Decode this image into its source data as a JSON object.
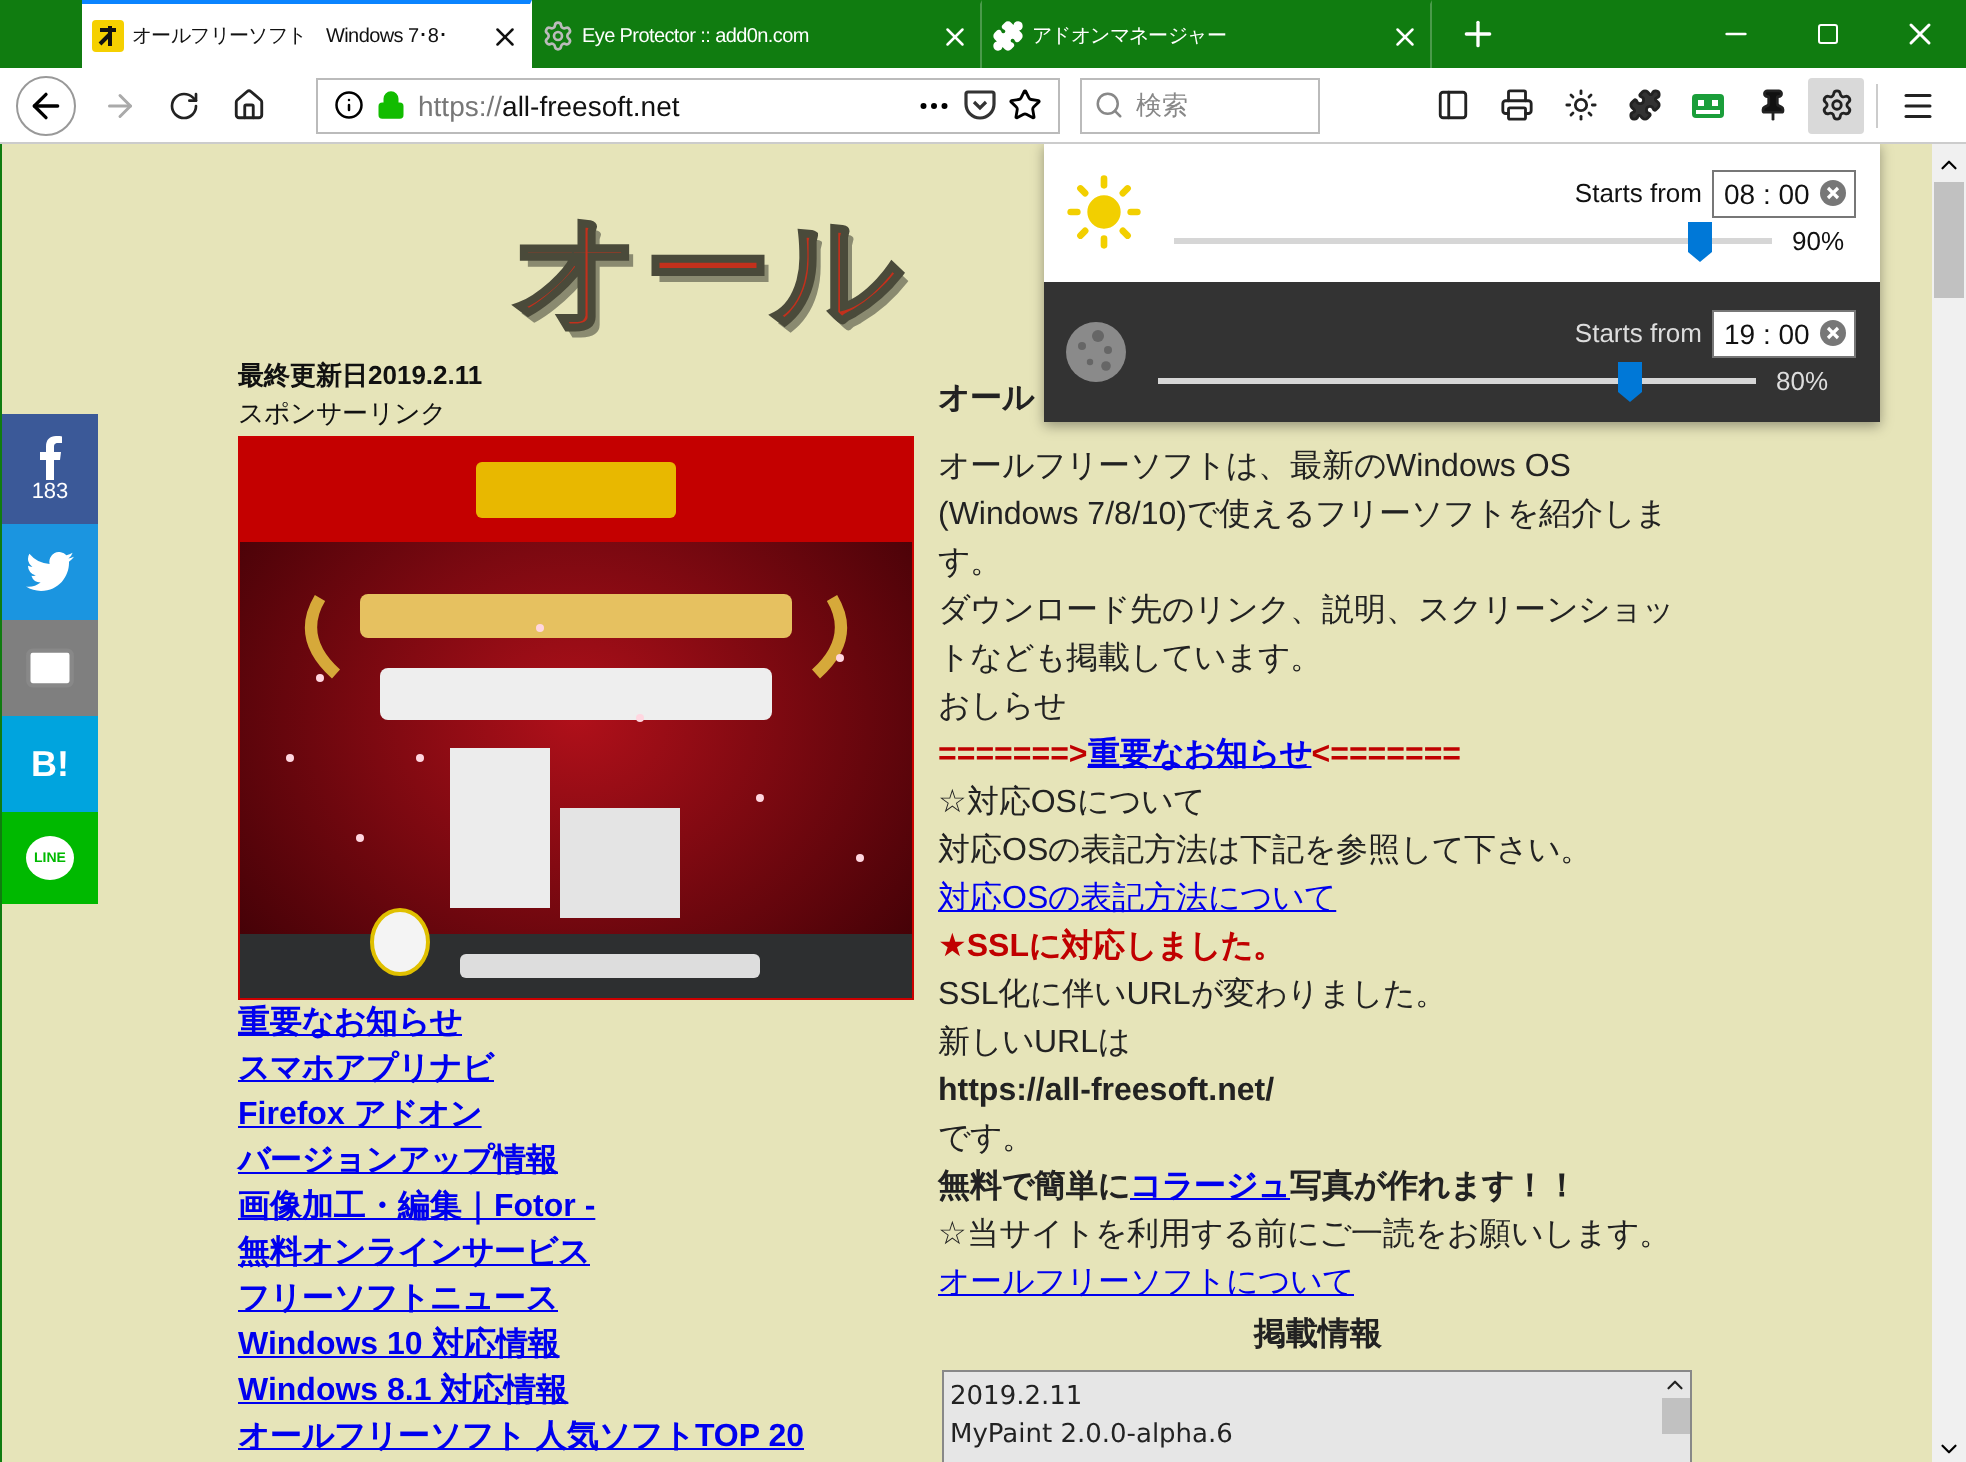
{
  "tabs": [
    {
      "kind": "site",
      "title": "オールフリーソフト　Windows 7･8･",
      "selected": true
    },
    {
      "kind": "gear",
      "title": "Eye Protector :: add0n.com",
      "selected": false
    },
    {
      "kind": "puzzle",
      "title": "アドオンマネージャー",
      "selected": false
    }
  ],
  "address_bar": {
    "scheme": "https://",
    "host": "all-freesoft.net"
  },
  "search": {
    "placeholder": "検索"
  },
  "toolbar_buttons": [
    {
      "kind": "sidebar",
      "active": false
    },
    {
      "kind": "print",
      "active": false
    },
    {
      "kind": "sun",
      "active": false
    },
    {
      "kind": "puzzle",
      "active": false
    },
    {
      "kind": "robot",
      "active": false
    },
    {
      "kind": "pin",
      "active": false
    },
    {
      "kind": "gear",
      "active": true
    }
  ],
  "popup": {
    "modes": [
      {
        "kind": "day",
        "label": "Starts from",
        "time": "08 : 00",
        "level": 0.88,
        "reading": "90%"
      },
      {
        "kind": "night",
        "label": "Starts from",
        "time": "19 : 00",
        "level": 0.79,
        "reading": "80%"
      }
    ]
  },
  "share_bar": [
    {
      "kind": "facebook",
      "color": "#3b5998",
      "count": "183"
    },
    {
      "kind": "twitter",
      "color": "#1b95e0"
    },
    {
      "kind": "mail",
      "color": "#7f7f7f"
    },
    {
      "kind": "hatena",
      "color": "#00a4de",
      "label": "B!"
    },
    {
      "kind": "line",
      "color": "#00b900",
      "label": "LINE"
    }
  ],
  "logo": "オール",
  "sidebar": {
    "updated": "最終更新日2019.2.11",
    "sponsor_label": "スポンサーリンク",
    "links": [
      "重要なお知らせ",
      "スマホアプリナビ",
      "Firefox アドオン",
      "バージョンアップ情報",
      "画像加工・編集｜Fotor -",
      "無料オンラインサービス",
      "フリーソフトニュース",
      "Windows 10 対応情報",
      "Windows 8.1 対応情報",
      "オールフリーソフト 人気ソフトTOP 20"
    ]
  },
  "article": {
    "heading": "オール",
    "blocks": [
      {
        "parts": [
          {
            "kind": "plain",
            "text": "オールフリーソフトは、最新のWindows OS (Windows 7/8/10)で使えるフリーソフトを紹介します。"
          }
        ]
      },
      {
        "parts": [
          {
            "kind": "plain",
            "text": "ダウンロード先のリンク、説明、スクリーンショットなども掲載しています。"
          }
        ]
      },
      {
        "parts": [
          {
            "kind": "plain",
            "text": "おしらせ"
          }
        ]
      },
      {
        "parts": [
          {
            "kind": "alert",
            "text": "=======>"
          },
          {
            "kind": "boldlink",
            "text": "重要なお知らせ"
          },
          {
            "kind": "alert",
            "text": "<======="
          }
        ]
      },
      {
        "parts": [
          {
            "kind": "plain",
            "text": "☆対応OSについて"
          }
        ]
      },
      {
        "parts": [
          {
            "kind": "plain",
            "text": "対応OSの表記方法は下記を参照して下さい。"
          }
        ]
      },
      {
        "parts": [
          {
            "kind": "link",
            "text": "対応OSの表記方法について"
          }
        ]
      },
      {
        "parts": [
          {
            "kind": "alert",
            "text": "★SSLに対応しました。"
          }
        ]
      },
      {
        "parts": [
          {
            "kind": "plain",
            "text": "SSL化に伴いURLが変わりました。"
          }
        ]
      },
      {
        "parts": [
          {
            "kind": "plain",
            "text": "新しいURLは"
          }
        ]
      },
      {
        "parts": [
          {
            "kind": "bold",
            "text": "https://all-freesoft.net/"
          }
        ]
      },
      {
        "parts": [
          {
            "kind": "plain",
            "text": "です。"
          }
        ]
      },
      {
        "parts": [
          {
            "kind": "bold",
            "text": "無料で簡単に"
          },
          {
            "kind": "boldlink",
            "text": "コラージュ"
          },
          {
            "kind": "bold",
            "text": "写真が作れます！！"
          }
        ]
      },
      {
        "parts": [
          {
            "kind": "plain",
            "text": "☆当サイトを利用する前にご一読をお願いします。"
          }
        ]
      },
      {
        "parts": [
          {
            "kind": "link",
            "text": "オールフリーソフトについて"
          }
        ]
      }
    ]
  },
  "listing": {
    "title": "掲載情報",
    "items": [
      "2019.2.11",
      "MyPaint 2.0.0-alpha.6"
    ]
  }
}
